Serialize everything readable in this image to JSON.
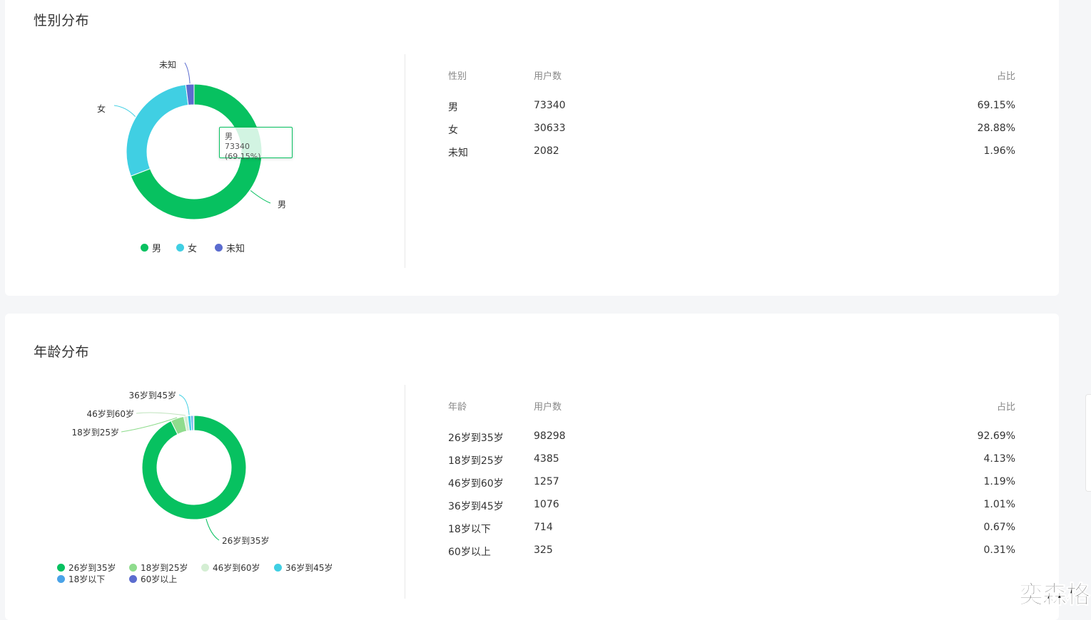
{
  "gender": {
    "title": "性别分布",
    "tooltip": {
      "name": "男",
      "value": "73340 (69.15%)"
    },
    "table": {
      "headers": [
        "性别",
        "用户数",
        "占比"
      ],
      "rows": [
        [
          "男",
          "73340",
          "69.15%"
        ],
        [
          "女",
          "30633",
          "28.88%"
        ],
        [
          "未知",
          "2082",
          "1.96%"
        ]
      ]
    },
    "chart_data": {
      "type": "pie",
      "donut": true,
      "categories": [
        "男",
        "女",
        "未知"
      ],
      "values": [
        73340,
        30633,
        2082
      ],
      "colors": [
        "#07c160",
        "#40cfe3",
        "#5b6ccf"
      ],
      "legend": "bottom"
    }
  },
  "age": {
    "title": "年龄分布",
    "table": {
      "headers": [
        "年龄",
        "用户数",
        "占比"
      ],
      "rows": [
        [
          "26岁到35岁",
          "98298",
          "92.69%"
        ],
        [
          "18岁到25岁",
          "4385",
          "4.13%"
        ],
        [
          "46岁到60岁",
          "1257",
          "1.19%"
        ],
        [
          "36岁到45岁",
          "1076",
          "1.01%"
        ],
        [
          "18岁以下",
          "714",
          "0.67%"
        ],
        [
          "60岁以上",
          "325",
          "0.31%"
        ]
      ]
    },
    "chart_data": {
      "type": "pie",
      "donut": true,
      "categories": [
        "26岁到35岁",
        "18岁到25岁",
        "46岁到60岁",
        "36岁到45岁",
        "18岁以下",
        "60岁以上"
      ],
      "values": [
        98298,
        4385,
        1257,
        1076,
        714,
        325
      ],
      "colors": [
        "#07c160",
        "#8fdc8d",
        "#d4eed3",
        "#40cfe3",
        "#4aa3e8",
        "#5b6ccf"
      ],
      "legend": "bottom"
    }
  },
  "watermark": "奕森格"
}
